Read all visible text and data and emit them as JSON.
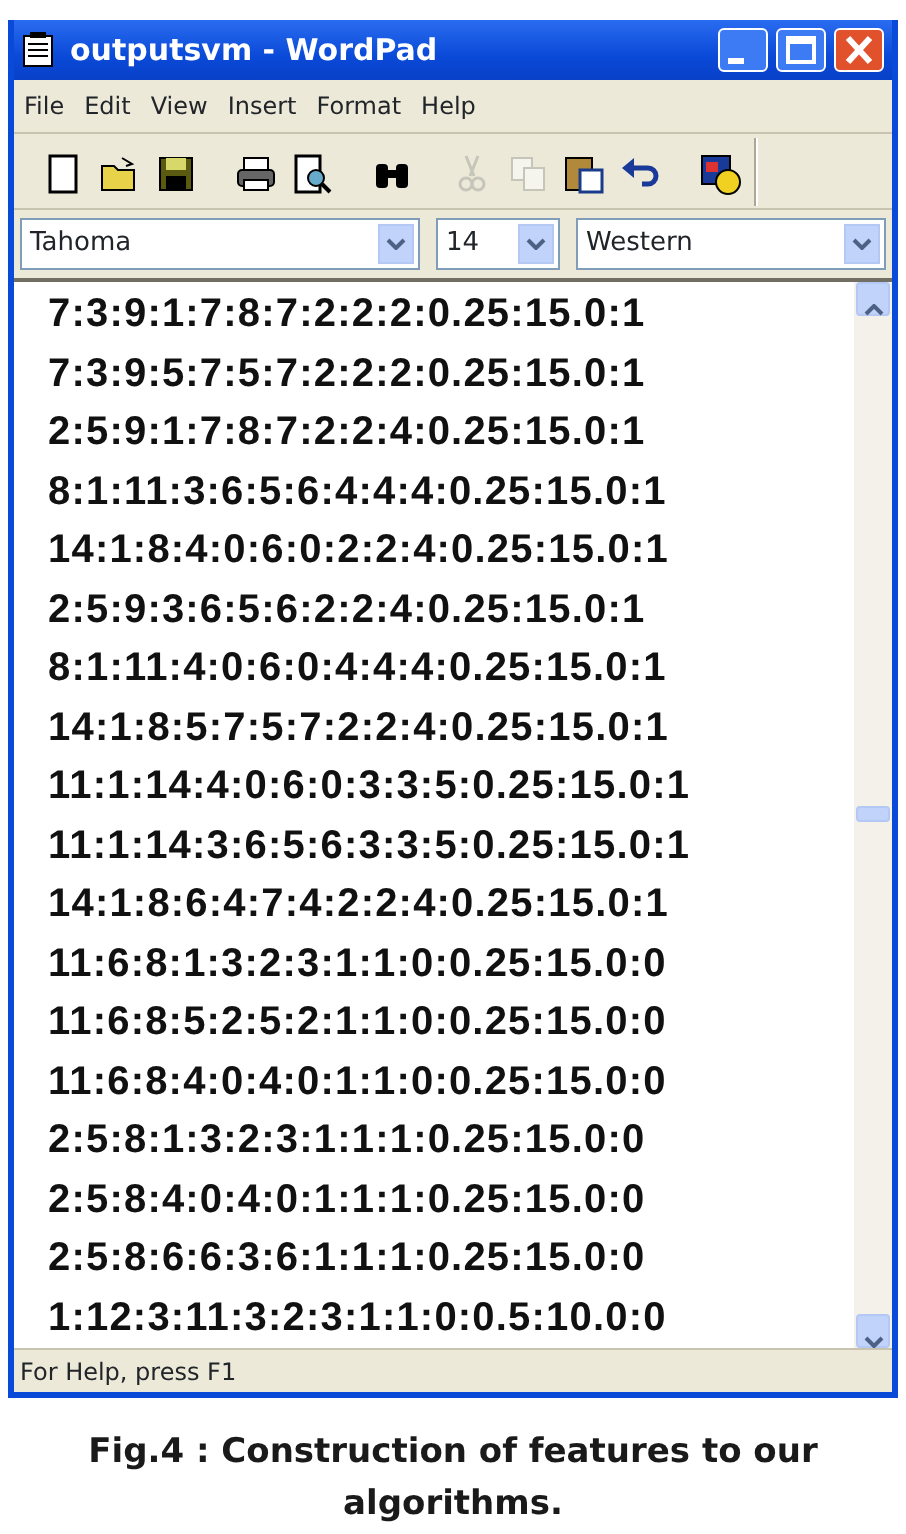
{
  "window": {
    "title": "outputsvm - WordPad"
  },
  "menu": [
    "File",
    "Edit",
    "View",
    "Insert",
    "Format",
    "Help"
  ],
  "toolbar": [
    {
      "kind": "new",
      "disabled": false
    },
    {
      "kind": "open",
      "disabled": false
    },
    {
      "kind": "save",
      "disabled": false
    },
    {
      "kind": "print",
      "disabled": false
    },
    {
      "kind": "preview",
      "disabled": false
    },
    {
      "kind": "find",
      "disabled": false
    },
    {
      "kind": "cut",
      "disabled": true
    },
    {
      "kind": "copy",
      "disabled": true
    },
    {
      "kind": "paste",
      "disabled": false
    },
    {
      "kind": "undo",
      "disabled": false
    },
    {
      "kind": "datetime",
      "disabled": false
    }
  ],
  "format_bar": {
    "font": "Tahoma",
    "size": "14",
    "script": "Western"
  },
  "document": {
    "lines": [
      "7:3:9:1:7:8:7:2:2:2:0.25:15.0:1",
      "7:3:9:5:7:5:7:2:2:2:0.25:15.0:1",
      "2:5:9:1:7:8:7:2:2:4:0.25:15.0:1",
      "8:1:11:3:6:5:6:4:4:4:0.25:15.0:1",
      "14:1:8:4:0:6:0:2:2:4:0.25:15.0:1",
      "2:5:9:3:6:5:6:2:2:4:0.25:15.0:1",
      "8:1:11:4:0:6:0:4:4:4:0.25:15.0:1",
      "14:1:8:5:7:5:7:2:2:4:0.25:15.0:1",
      "11:1:14:4:0:6:0:3:3:5:0.25:15.0:1",
      "11:1:14:3:6:5:6:3:3:5:0.25:15.0:1",
      "14:1:8:6:4:7:4:2:2:4:0.25:15.0:1",
      "11:6:8:1:3:2:3:1:1:0:0.25:15.0:0",
      "11:6:8:5:2:5:2:1:1:0:0.25:15.0:0",
      "11:6:8:4:0:4:0:1:1:0:0.25:15.0:0",
      "2:5:8:1:3:2:3:1:1:1:0.25:15.0:0",
      "2:5:8:4:0:4:0:1:1:1:0.25:15.0:0",
      "2:5:8:6:6:3:6:1:1:1:0.25:15.0:0",
      "1:12:3:11:3:2:3:1:1:0:0.5:10.0:0"
    ]
  },
  "status_bar": "For Help, press F1",
  "caption": "Fig.4 : Construction of features to our algorithms."
}
